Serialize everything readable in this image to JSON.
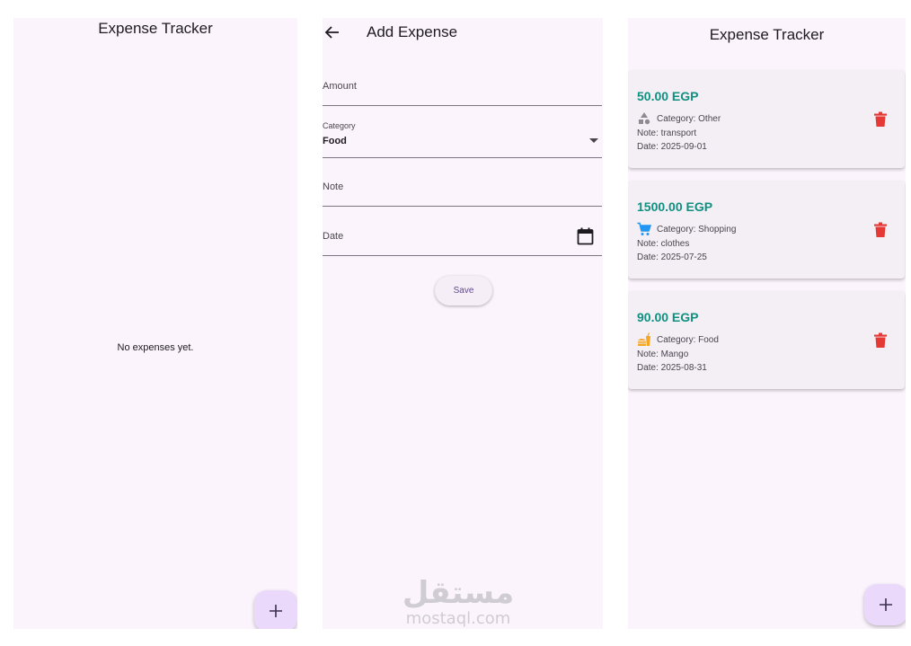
{
  "screen_empty": {
    "title": "Expense Tracker",
    "empty_message": "No expenses yet.",
    "fab_icon": "add-icon"
  },
  "screen_add": {
    "title": "Add Expense",
    "back_icon": "arrow-back-icon",
    "amount": {
      "label": "Amount",
      "value": ""
    },
    "category": {
      "label": "Category",
      "value": "Food",
      "icon": "dropdown-arrow-icon"
    },
    "note": {
      "label": "Note",
      "value": ""
    },
    "date": {
      "label": "Date",
      "value": "",
      "icon": "calendar-icon"
    },
    "save_label": "Save"
  },
  "screen_list": {
    "title": "Expense Tracker",
    "fab_icon": "add-icon",
    "expenses": [
      {
        "amount": "50.00 EGP",
        "category": "Category: Other",
        "category_icon": "category-shapes-icon",
        "note": "Note: transport",
        "date": "Date: 2025-09-01"
      },
      {
        "amount": "1500.00 EGP",
        "category": "Category: Shopping",
        "category_icon": "shopping-cart-icon",
        "note": "Note: clothes",
        "date": "Date: 2025-07-25"
      },
      {
        "amount": "90.00 EGP",
        "category": "Category: Food",
        "category_icon": "fastfood-icon",
        "note": "Note: Mango",
        "date": "Date: 2025-08-31"
      }
    ]
  },
  "watermark": {
    "arabic": "مستقل",
    "latin": "mostaql.com"
  },
  "colors": {
    "background": "#fcf4fc",
    "accent_amount": "#0f9080",
    "delete_red": "#e53935",
    "fab": "#ead9fb",
    "cart_blue": "#2196f3",
    "food_orange": "#f5a623"
  }
}
